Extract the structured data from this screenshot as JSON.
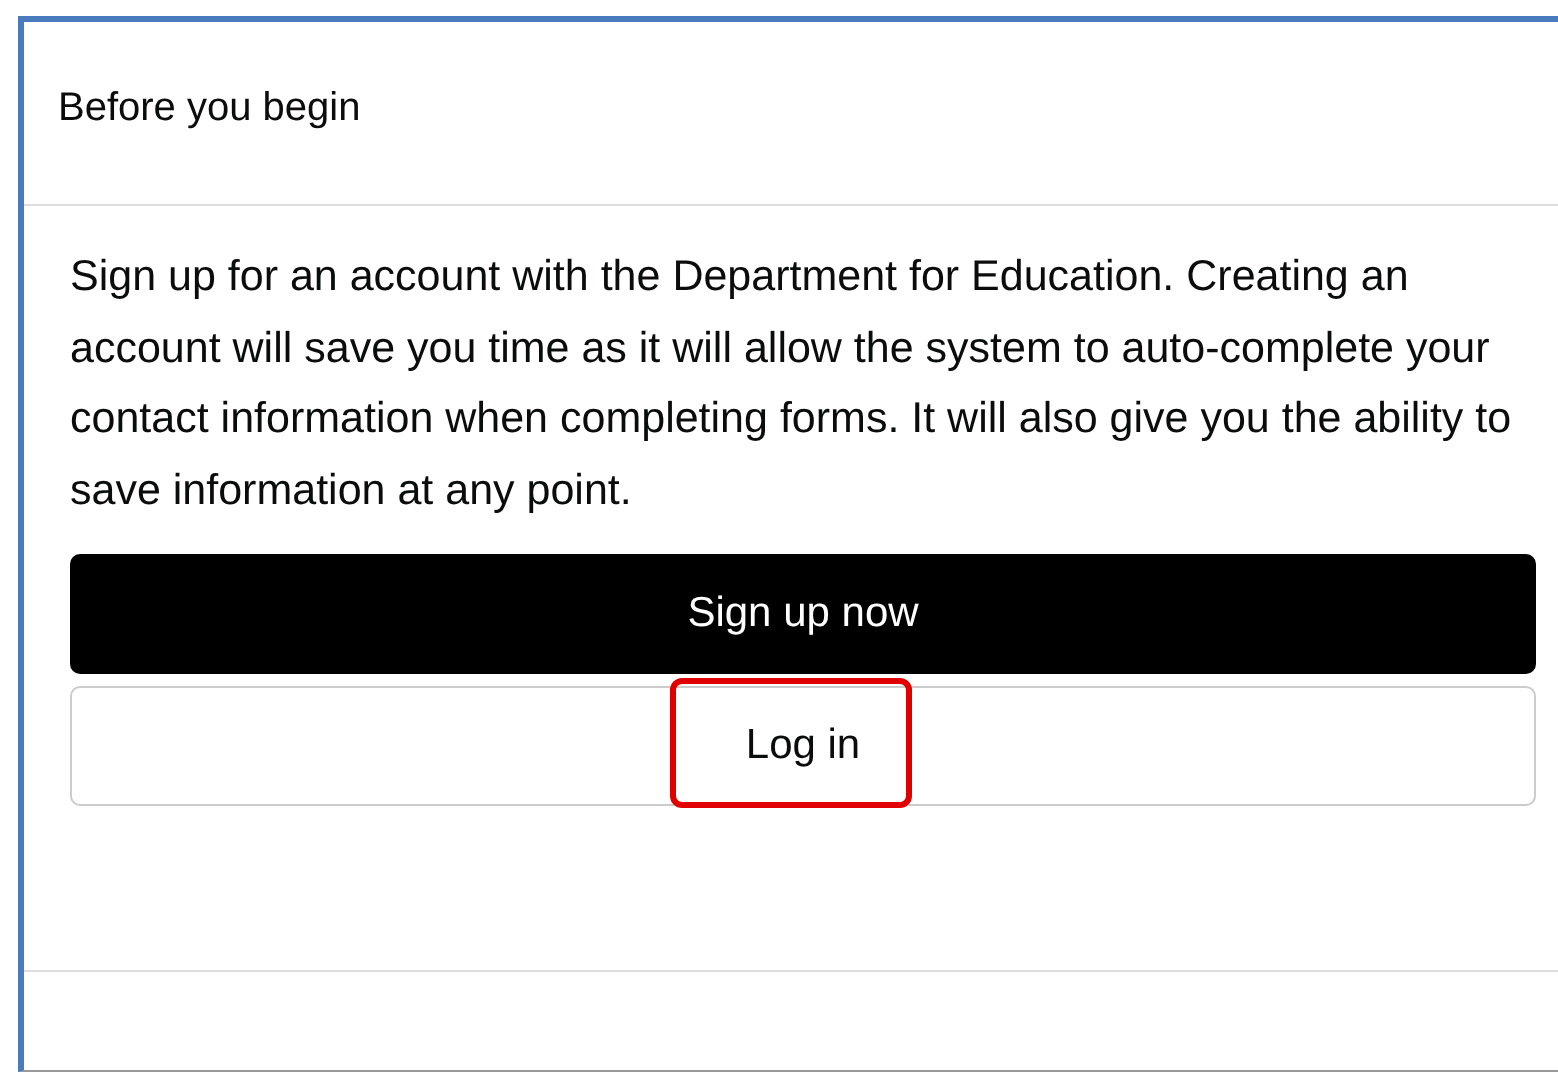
{
  "dialog": {
    "title": "Before you begin",
    "message": "Sign up for an account with the Department for Education. Creating an account will save you time as it will allow the system to auto-complete your contact information when completing forms. It will also give you the ability to save information at any point.",
    "buttons": [
      {
        "label": "Sign up now",
        "kind": "primary",
        "highlighted": false
      },
      {
        "label": "Log in",
        "kind": "secondary",
        "highlighted": true
      }
    ]
  }
}
